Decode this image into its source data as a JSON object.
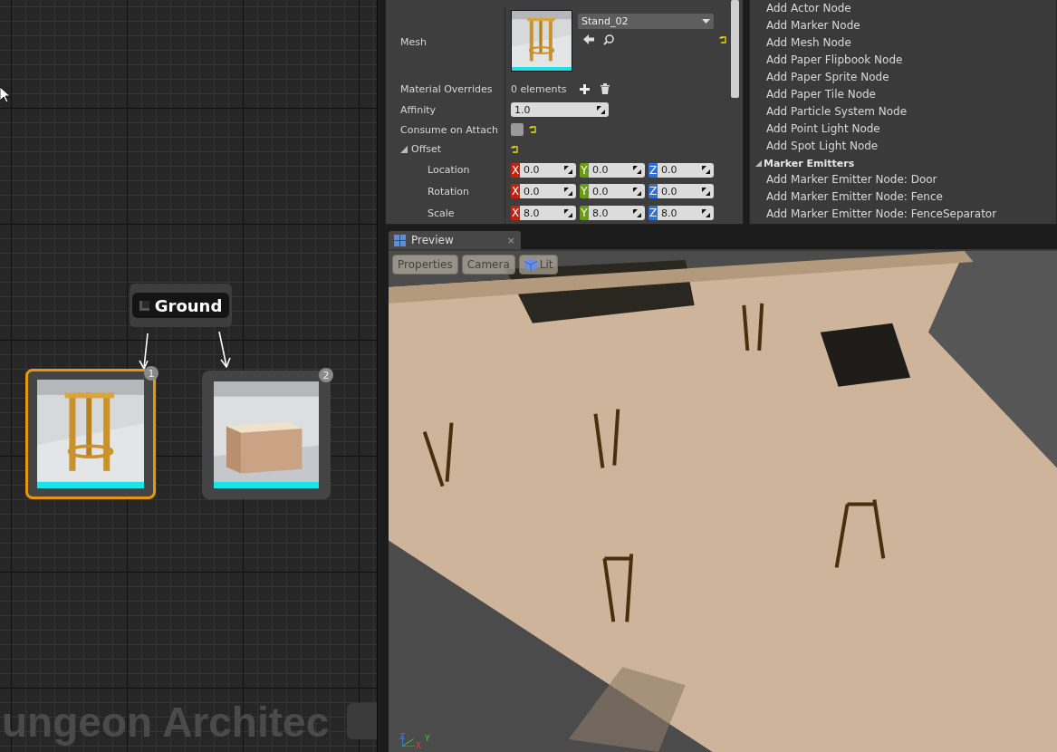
{
  "graph": {
    "watermark": "ungeon Architec",
    "root_node": {
      "label": "Ground"
    },
    "nodes": [
      {
        "badge": "1",
        "selected": true
      },
      {
        "badge": "2",
        "selected": false
      }
    ]
  },
  "details": {
    "rows": [
      {
        "kind": "mesh",
        "label": "Mesh",
        "value": "Stand_02",
        "resettable": true
      },
      {
        "kind": "array",
        "label": "Material Overrides",
        "value": "0 elements",
        "resettable": false
      },
      {
        "kind": "number",
        "label": "Affinity",
        "value": "1.0",
        "resettable": false
      },
      {
        "kind": "checkbox",
        "label": "Consume on Attach",
        "checked": false,
        "resettable": true
      },
      {
        "kind": "group",
        "label": "Offset",
        "expanded": true,
        "resettable": true,
        "children": [
          {
            "kind": "vector",
            "label": "Location",
            "values": [
              {
                "axis": "X",
                "value": "0.0",
                "color": "#c8200e"
              },
              {
                "axis": "Y",
                "value": "0.0",
                "color": "#6a9b12"
              },
              {
                "axis": "Z",
                "value": "0.0",
                "color": "#2f6fd6"
              }
            ]
          },
          {
            "kind": "vector",
            "label": "Rotation",
            "values": [
              {
                "axis": "X",
                "value": "0.0",
                "color": "#c8200e"
              },
              {
                "axis": "Y",
                "value": "0.0",
                "color": "#6a9b12"
              },
              {
                "axis": "Z",
                "value": "0.0",
                "color": "#2f6fd6"
              }
            ]
          },
          {
            "kind": "vector",
            "label": "Scale",
            "values": [
              {
                "axis": "X",
                "value": "8.0",
                "color": "#c8200e"
              },
              {
                "axis": "Y",
                "value": "8.0",
                "color": "#6a9b12"
              },
              {
                "axis": "Z",
                "value": "8.0",
                "color": "#2f6fd6"
              }
            ]
          }
        ]
      }
    ]
  },
  "palette": {
    "items": [
      "Add Actor Node",
      "Add Marker Node",
      "Add Mesh Node",
      "Add Paper Flipbook Node",
      "Add Paper Sprite Node",
      "Add Paper Tile Node",
      "Add Particle System Node",
      "Add Point Light Node",
      "Add Spot Light Node"
    ],
    "sections": [
      {
        "title": "Marker Emitters",
        "expanded": true,
        "items": [
          "Add Marker Emitter Node: Door",
          "Add Marker Emitter Node: Fence",
          "Add Marker Emitter Node: FenceSeparator"
        ]
      }
    ]
  },
  "preview": {
    "tab": {
      "title": "Preview",
      "close": "×"
    },
    "toolbar": [
      "Properties",
      "Camera",
      "Lit"
    ],
    "axes": [
      "Z",
      "X",
      "Y"
    ]
  }
}
